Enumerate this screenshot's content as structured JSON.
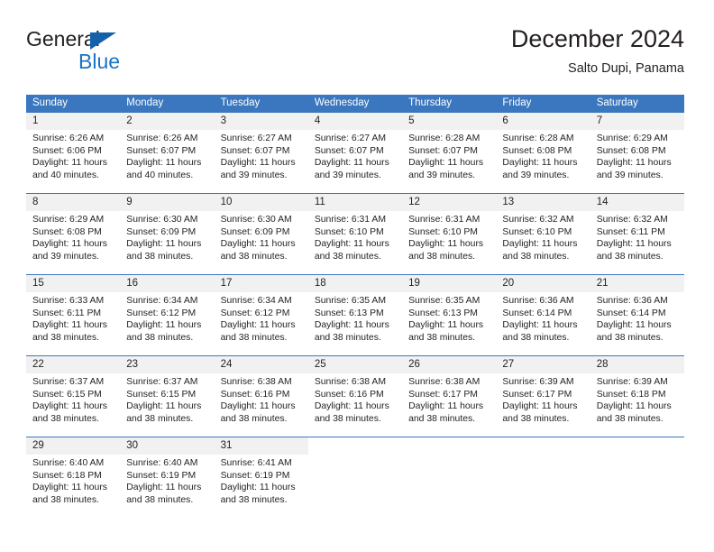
{
  "logo": {
    "word_one": "General",
    "word_two": "Blue",
    "triangle_color": "#1461ab",
    "blue_color": "#1a73c4"
  },
  "header": {
    "title": "December 2024",
    "subtitle": "Salto Dupi, Panama"
  },
  "theme": {
    "header_blue": "#3a77bf",
    "date_band": "#f1f1f1",
    "text": "#231f20"
  },
  "calendar": {
    "weekday_headers": [
      "Sunday",
      "Monday",
      "Tuesday",
      "Wednesday",
      "Thursday",
      "Friday",
      "Saturday"
    ],
    "labels": {
      "sunrise": "Sunrise:",
      "sunset": "Sunset:",
      "daylight": "Daylight:"
    },
    "weeks": [
      [
        {
          "day": "1",
          "sunrise": "Sunrise: 6:26 AM",
          "sunset": "Sunset: 6:06 PM",
          "daylight_line1": "Daylight: 11 hours",
          "daylight_line2": "and 40 minutes."
        },
        {
          "day": "2",
          "sunrise": "Sunrise: 6:26 AM",
          "sunset": "Sunset: 6:07 PM",
          "daylight_line1": "Daylight: 11 hours",
          "daylight_line2": "and 40 minutes."
        },
        {
          "day": "3",
          "sunrise": "Sunrise: 6:27 AM",
          "sunset": "Sunset: 6:07 PM",
          "daylight_line1": "Daylight: 11 hours",
          "daylight_line2": "and 39 minutes."
        },
        {
          "day": "4",
          "sunrise": "Sunrise: 6:27 AM",
          "sunset": "Sunset: 6:07 PM",
          "daylight_line1": "Daylight: 11 hours",
          "daylight_line2": "and 39 minutes."
        },
        {
          "day": "5",
          "sunrise": "Sunrise: 6:28 AM",
          "sunset": "Sunset: 6:07 PM",
          "daylight_line1": "Daylight: 11 hours",
          "daylight_line2": "and 39 minutes."
        },
        {
          "day": "6",
          "sunrise": "Sunrise: 6:28 AM",
          "sunset": "Sunset: 6:08 PM",
          "daylight_line1": "Daylight: 11 hours",
          "daylight_line2": "and 39 minutes."
        },
        {
          "day": "7",
          "sunrise": "Sunrise: 6:29 AM",
          "sunset": "Sunset: 6:08 PM",
          "daylight_line1": "Daylight: 11 hours",
          "daylight_line2": "and 39 minutes."
        }
      ],
      [
        {
          "day": "8",
          "sunrise": "Sunrise: 6:29 AM",
          "sunset": "Sunset: 6:08 PM",
          "daylight_line1": "Daylight: 11 hours",
          "daylight_line2": "and 39 minutes."
        },
        {
          "day": "9",
          "sunrise": "Sunrise: 6:30 AM",
          "sunset": "Sunset: 6:09 PM",
          "daylight_line1": "Daylight: 11 hours",
          "daylight_line2": "and 38 minutes."
        },
        {
          "day": "10",
          "sunrise": "Sunrise: 6:30 AM",
          "sunset": "Sunset: 6:09 PM",
          "daylight_line1": "Daylight: 11 hours",
          "daylight_line2": "and 38 minutes."
        },
        {
          "day": "11",
          "sunrise": "Sunrise: 6:31 AM",
          "sunset": "Sunset: 6:10 PM",
          "daylight_line1": "Daylight: 11 hours",
          "daylight_line2": "and 38 minutes."
        },
        {
          "day": "12",
          "sunrise": "Sunrise: 6:31 AM",
          "sunset": "Sunset: 6:10 PM",
          "daylight_line1": "Daylight: 11 hours",
          "daylight_line2": "and 38 minutes."
        },
        {
          "day": "13",
          "sunrise": "Sunrise: 6:32 AM",
          "sunset": "Sunset: 6:10 PM",
          "daylight_line1": "Daylight: 11 hours",
          "daylight_line2": "and 38 minutes."
        },
        {
          "day": "14",
          "sunrise": "Sunrise: 6:32 AM",
          "sunset": "Sunset: 6:11 PM",
          "daylight_line1": "Daylight: 11 hours",
          "daylight_line2": "and 38 minutes."
        }
      ],
      [
        {
          "day": "15",
          "sunrise": "Sunrise: 6:33 AM",
          "sunset": "Sunset: 6:11 PM",
          "daylight_line1": "Daylight: 11 hours",
          "daylight_line2": "and 38 minutes."
        },
        {
          "day": "16",
          "sunrise": "Sunrise: 6:34 AM",
          "sunset": "Sunset: 6:12 PM",
          "daylight_line1": "Daylight: 11 hours",
          "daylight_line2": "and 38 minutes."
        },
        {
          "day": "17",
          "sunrise": "Sunrise: 6:34 AM",
          "sunset": "Sunset: 6:12 PM",
          "daylight_line1": "Daylight: 11 hours",
          "daylight_line2": "and 38 minutes."
        },
        {
          "day": "18",
          "sunrise": "Sunrise: 6:35 AM",
          "sunset": "Sunset: 6:13 PM",
          "daylight_line1": "Daylight: 11 hours",
          "daylight_line2": "and 38 minutes."
        },
        {
          "day": "19",
          "sunrise": "Sunrise: 6:35 AM",
          "sunset": "Sunset: 6:13 PM",
          "daylight_line1": "Daylight: 11 hours",
          "daylight_line2": "and 38 minutes."
        },
        {
          "day": "20",
          "sunrise": "Sunrise: 6:36 AM",
          "sunset": "Sunset: 6:14 PM",
          "daylight_line1": "Daylight: 11 hours",
          "daylight_line2": "and 38 minutes."
        },
        {
          "day": "21",
          "sunrise": "Sunrise: 6:36 AM",
          "sunset": "Sunset: 6:14 PM",
          "daylight_line1": "Daylight: 11 hours",
          "daylight_line2": "and 38 minutes."
        }
      ],
      [
        {
          "day": "22",
          "sunrise": "Sunrise: 6:37 AM",
          "sunset": "Sunset: 6:15 PM",
          "daylight_line1": "Daylight: 11 hours",
          "daylight_line2": "and 38 minutes."
        },
        {
          "day": "23",
          "sunrise": "Sunrise: 6:37 AM",
          "sunset": "Sunset: 6:15 PM",
          "daylight_line1": "Daylight: 11 hours",
          "daylight_line2": "and 38 minutes."
        },
        {
          "day": "24",
          "sunrise": "Sunrise: 6:38 AM",
          "sunset": "Sunset: 6:16 PM",
          "daylight_line1": "Daylight: 11 hours",
          "daylight_line2": "and 38 minutes."
        },
        {
          "day": "25",
          "sunrise": "Sunrise: 6:38 AM",
          "sunset": "Sunset: 6:16 PM",
          "daylight_line1": "Daylight: 11 hours",
          "daylight_line2": "and 38 minutes."
        },
        {
          "day": "26",
          "sunrise": "Sunrise: 6:38 AM",
          "sunset": "Sunset: 6:17 PM",
          "daylight_line1": "Daylight: 11 hours",
          "daylight_line2": "and 38 minutes."
        },
        {
          "day": "27",
          "sunrise": "Sunrise: 6:39 AM",
          "sunset": "Sunset: 6:17 PM",
          "daylight_line1": "Daylight: 11 hours",
          "daylight_line2": "and 38 minutes."
        },
        {
          "day": "28",
          "sunrise": "Sunrise: 6:39 AM",
          "sunset": "Sunset: 6:18 PM",
          "daylight_line1": "Daylight: 11 hours",
          "daylight_line2": "and 38 minutes."
        }
      ],
      [
        {
          "day": "29",
          "sunrise": "Sunrise: 6:40 AM",
          "sunset": "Sunset: 6:18 PM",
          "daylight_line1": "Daylight: 11 hours",
          "daylight_line2": "and 38 minutes."
        },
        {
          "day": "30",
          "sunrise": "Sunrise: 6:40 AM",
          "sunset": "Sunset: 6:19 PM",
          "daylight_line1": "Daylight: 11 hours",
          "daylight_line2": "and 38 minutes."
        },
        {
          "day": "31",
          "sunrise": "Sunrise: 6:41 AM",
          "sunset": "Sunset: 6:19 PM",
          "daylight_line1": "Daylight: 11 hours",
          "daylight_line2": "and 38 minutes."
        },
        {
          "day": "",
          "sunrise": "",
          "sunset": "",
          "daylight_line1": "",
          "daylight_line2": ""
        },
        {
          "day": "",
          "sunrise": "",
          "sunset": "",
          "daylight_line1": "",
          "daylight_line2": ""
        },
        {
          "day": "",
          "sunrise": "",
          "sunset": "",
          "daylight_line1": "",
          "daylight_line2": ""
        },
        {
          "day": "",
          "sunrise": "",
          "sunset": "",
          "daylight_line1": "",
          "daylight_line2": ""
        }
      ]
    ]
  }
}
